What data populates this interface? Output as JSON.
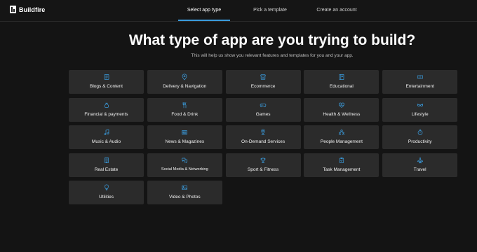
{
  "brand": {
    "name": "Buildfire"
  },
  "steps": [
    {
      "label": "Select app type",
      "active": true
    },
    {
      "label": "Pick a template",
      "active": false
    },
    {
      "label": "Create an account",
      "active": false
    }
  ],
  "hero": {
    "title": "What type of app are you trying to build?",
    "subtitle": "This will help us show you relevant features and templates for you and your app."
  },
  "colors": {
    "accent": "#3a9bdc",
    "tile_bg": "#2b2b2b",
    "page_bg": "#141414"
  },
  "categories": [
    {
      "label": "Blogs & Content",
      "icon": "blog-icon"
    },
    {
      "label": "Delivery & Navigation",
      "icon": "location-pin-icon"
    },
    {
      "label": "Ecommerce",
      "icon": "storefront-icon"
    },
    {
      "label": "Educational",
      "icon": "book-icon"
    },
    {
      "label": "Entertainment",
      "icon": "ticket-icon"
    },
    {
      "label": "Financial & payments",
      "icon": "money-bag-icon"
    },
    {
      "label": "Food & Drink",
      "icon": "fork-knife-icon"
    },
    {
      "label": "Games",
      "icon": "gamepad-icon"
    },
    {
      "label": "Health & Wellness",
      "icon": "heart-pulse-icon"
    },
    {
      "label": "Lifestyle",
      "icon": "glasses-icon"
    },
    {
      "label": "Music & Audio",
      "icon": "music-note-icon"
    },
    {
      "label": "News & Magazines",
      "icon": "newspaper-icon"
    },
    {
      "label": "On-Demand Services",
      "icon": "map-pin-icon"
    },
    {
      "label": "People Management",
      "icon": "people-icon"
    },
    {
      "label": "Productivity",
      "icon": "stopwatch-icon"
    },
    {
      "label": "Real Estate",
      "icon": "building-icon"
    },
    {
      "label": "Social Media & Networking",
      "icon": "chat-bubbles-icon"
    },
    {
      "label": "Sport & Fitness",
      "icon": "trophy-icon"
    },
    {
      "label": "Task Management",
      "icon": "clipboard-check-icon"
    },
    {
      "label": "Travel",
      "icon": "airplane-icon"
    },
    {
      "label": "Utilities",
      "icon": "lightbulb-icon"
    },
    {
      "label": "Video & Photos",
      "icon": "image-icon"
    }
  ]
}
